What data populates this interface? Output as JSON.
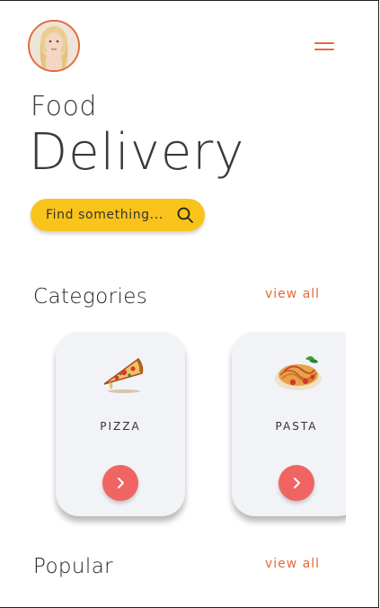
{
  "header": {
    "avatar": "user-avatar",
    "menu_icon": "hamburger-menu-icon"
  },
  "title": {
    "line1": "Food",
    "line2": "Delivery"
  },
  "search": {
    "placeholder": "Find something...",
    "icon": "search-icon",
    "color": "#f9c31b"
  },
  "categories": {
    "title": "Categories",
    "view_all": "view all",
    "items": [
      {
        "label": "PIZZA",
        "icon": "pizza-slice-icon"
      },
      {
        "label": "PASTA",
        "icon": "spaghetti-icon"
      }
    ]
  },
  "popular": {
    "title": "Popular",
    "view_all": "view all"
  },
  "colors": {
    "accent": "#e46a3b",
    "button": "#f06464",
    "card": "#f2f3f7"
  }
}
